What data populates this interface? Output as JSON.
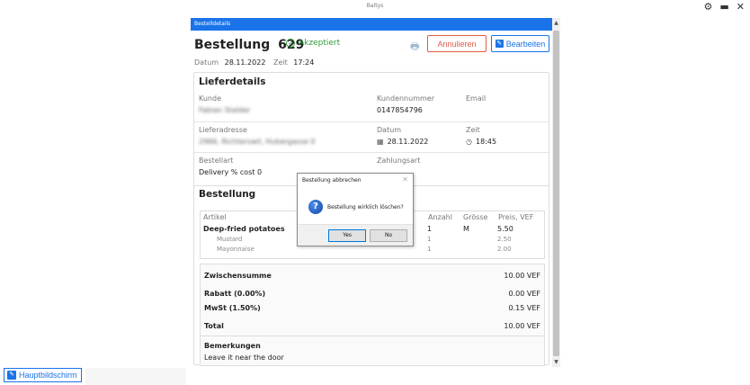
{
  "window": {
    "app_title": "Baltys"
  },
  "panel": {
    "header": "Bestelldetails"
  },
  "order": {
    "title": "Bestellung",
    "number": "629",
    "status": "Akzeptiert",
    "cancel_label": "Annulieren",
    "edit_label": "Bearbeiten",
    "date_label": "Datum",
    "date_value": "28.11.2022",
    "time_label": "Zeit",
    "time_value": "17:24"
  },
  "delivery": {
    "title": "Lieferdetails",
    "customer_label": "Kunde",
    "customer_value": "Fabian Stalder",
    "customer_number_label": "Kundennummer",
    "customer_number_value": "0147854796",
    "email_label": "Email",
    "address_label": "Lieferadresse",
    "address_value": "2966, Richterswil, Hubergasse 0",
    "delivery_date_label": "Datum",
    "delivery_date_value": "28.11.2022",
    "delivery_time_label": "Zeit",
    "delivery_time_value": "18:45",
    "order_type_label": "Bestellart",
    "order_type_value": "Delivery % cost 0",
    "payment_label": "Zahlungsart"
  },
  "items_section": {
    "title": "Bestellung",
    "columns": {
      "article": "Artikel",
      "qty": "Anzahl",
      "size": "Grösse",
      "price": "Preis, VEF"
    },
    "items": [
      {
        "name": "Deep-fried potatoes",
        "qty": "1",
        "size": "M",
        "price": "5.50"
      }
    ],
    "subitems": [
      {
        "name": "Mustard",
        "qty": "1",
        "price": "2.50"
      },
      {
        "name": "Mayonnaise",
        "qty": "1",
        "price": "2.00"
      }
    ]
  },
  "totals": {
    "subtotal_label": "Zwischensumme",
    "subtotal_value": "10.00 VEF",
    "discount_label": "Rabatt (0.00%)",
    "discount_value": "0.00 VEF",
    "tax_label": "MwSt (1.50%)",
    "tax_value": "0.15 VEF",
    "total_label": "Total",
    "total_value": "10.00 VEF"
  },
  "notes": {
    "label": "Bemerkungen",
    "value": "Leave it near the door"
  },
  "dialog": {
    "title": "Bestellung abbrechen",
    "message": "Bestellung wirklich löschen?",
    "yes_label": "Yes",
    "no_label": "No"
  },
  "footer": {
    "home_label": "Hauptbildschirm"
  },
  "colors": {
    "accent": "#1a73e8",
    "danger": "#e25b4a",
    "success": "#2e9b3a"
  }
}
